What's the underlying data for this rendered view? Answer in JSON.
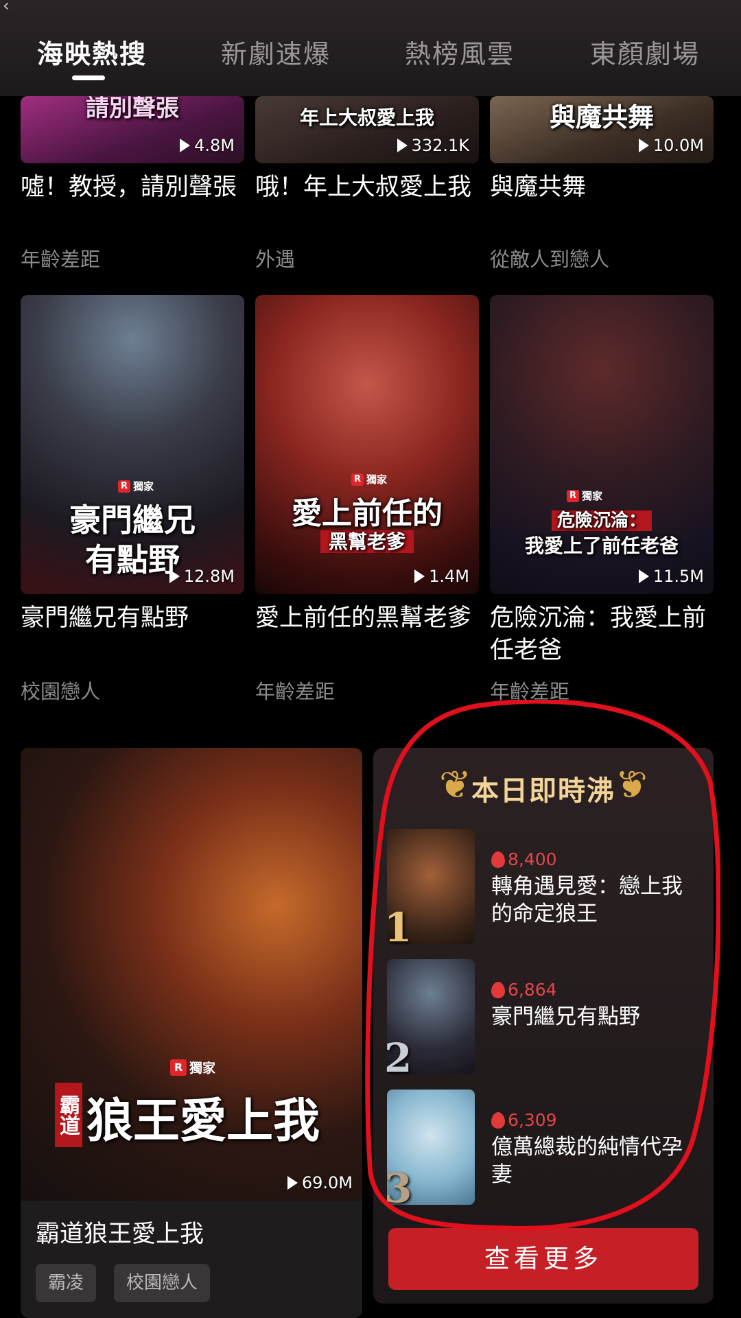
{
  "header": {
    "tabs": [
      {
        "label": "海映熱搜",
        "active": true
      },
      {
        "label": "新劇速爆",
        "active": false
      },
      {
        "label": "熱榜風雲",
        "active": false
      },
      {
        "label": "東顏劇場",
        "active": false
      }
    ]
  },
  "row1": [
    {
      "poster_text": "請別聲張",
      "views": "4.8M",
      "title": "噓！教授，請別聲張",
      "tag": "年齡差距"
    },
    {
      "poster_text": "年上大叔愛上我",
      "views": "332.1K",
      "title": "哦！年上大叔愛上我",
      "tag": "外遇"
    },
    {
      "poster_text": "與魔共舞",
      "views": "10.0M",
      "title": "與魔共舞",
      "tag": "從敵人到戀人"
    }
  ],
  "row2": [
    {
      "badge": "獨家",
      "poster_text_1": "豪門繼兄",
      "poster_text_2": "有點野",
      "views": "12.8M",
      "title": "豪門繼兄有點野",
      "tag": "校園戀人"
    },
    {
      "badge": "獨家",
      "poster_text_1": "愛上前任的",
      "poster_text_2": "黑幫老爹",
      "views": "1.4M",
      "title": "愛上前任的黑幫老爹",
      "tag": "年齡差距"
    },
    {
      "badge": "獨家",
      "poster_text_1": "危險沉淪：",
      "poster_text_2": "我愛上了前任老爸",
      "views": "11.5M",
      "title": "危險沉淪：我愛上前任老爸",
      "tag": "年齡差距"
    }
  ],
  "feature": {
    "badge": "獨家",
    "poster_text_small": "霸道",
    "poster_text": "狼王愛上我",
    "views": "69.0M",
    "title": "霸道狼王愛上我",
    "chips": [
      "霸凌",
      "校園戀人"
    ]
  },
  "ranking": {
    "heading": "本日即時沸",
    "items": [
      {
        "rank": "1",
        "heat": "8,400",
        "title": "轉角遇見愛：戀上我的命定狼王"
      },
      {
        "rank": "2",
        "heat": "6,864",
        "title": "豪門繼兄有點野"
      },
      {
        "rank": "3",
        "heat": "6,309",
        "title": "億萬總裁的純情代孕妻"
      }
    ],
    "more_label": "查看更多"
  },
  "colors": {
    "accent": "#c62026",
    "heat": "#e2464a",
    "gold": "#f3d59a",
    "marker": "#e0101c"
  }
}
